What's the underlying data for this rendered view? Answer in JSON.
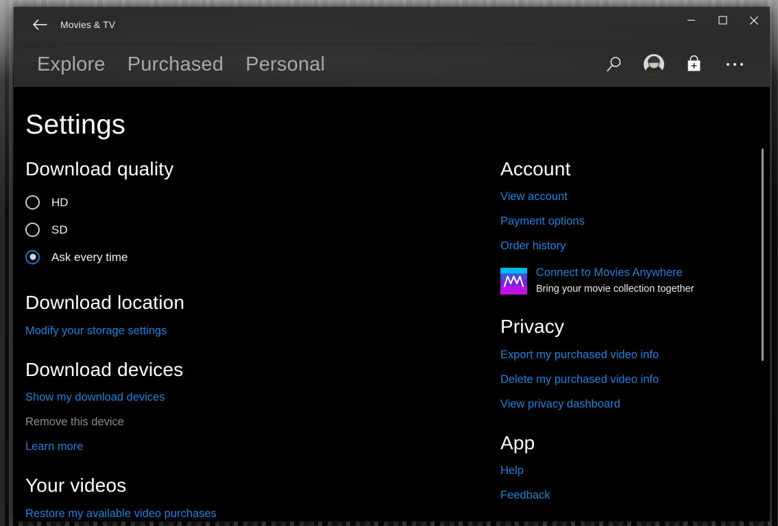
{
  "window": {
    "title": "Movies & TV",
    "back_icon": "back-arrow-icon",
    "controls": {
      "minimize": "minimize-icon",
      "maximize": "maximize-icon",
      "close": "close-icon"
    }
  },
  "nav": {
    "tabs": [
      {
        "label": "Explore"
      },
      {
        "label": "Purchased"
      },
      {
        "label": "Personal"
      }
    ],
    "actions": [
      {
        "name": "search-icon",
        "label": "Search"
      },
      {
        "name": "avatar",
        "label": "Account"
      },
      {
        "name": "store-bag-icon",
        "label": "Store"
      },
      {
        "name": "more-icon",
        "label": "More"
      }
    ]
  },
  "page": {
    "title": "Settings"
  },
  "colors": {
    "link": "#2b7fd4",
    "accent": "#1f78d1",
    "disabled": "#8d8d8d",
    "header_bg": "#2b2b2b",
    "content_bg": "#000000"
  },
  "left": {
    "download_quality": {
      "title": "Download quality",
      "options": [
        {
          "label": "HD",
          "selected": false
        },
        {
          "label": "SD",
          "selected": false
        },
        {
          "label": "Ask every time",
          "selected": true
        }
      ]
    },
    "download_location": {
      "title": "Download location",
      "links": [
        {
          "label": "Modify your storage settings",
          "disabled": false
        }
      ]
    },
    "download_devices": {
      "title": "Download devices",
      "links": [
        {
          "label": "Show my download devices",
          "disabled": false
        },
        {
          "label": "Remove this device",
          "disabled": true
        },
        {
          "label": "Learn more",
          "disabled": false
        }
      ]
    },
    "your_videos": {
      "title": "Your videos",
      "links": [
        {
          "label": "Restore my available video purchases",
          "disabled": false
        }
      ]
    }
  },
  "right": {
    "account": {
      "title": "Account",
      "links": [
        {
          "label": "View account"
        },
        {
          "label": "Payment options"
        },
        {
          "label": "Order history"
        }
      ],
      "promo": {
        "logo": "movies-anywhere-logo",
        "title": "Connect to Movies Anywhere",
        "subtitle": "Bring your movie collection together"
      }
    },
    "privacy": {
      "title": "Privacy",
      "links": [
        {
          "label": "Export my purchased video info"
        },
        {
          "label": "Delete my purchased video info"
        },
        {
          "label": "View privacy dashboard"
        }
      ]
    },
    "app": {
      "title": "App",
      "links": [
        {
          "label": "Help"
        },
        {
          "label": "Feedback"
        }
      ]
    }
  }
}
